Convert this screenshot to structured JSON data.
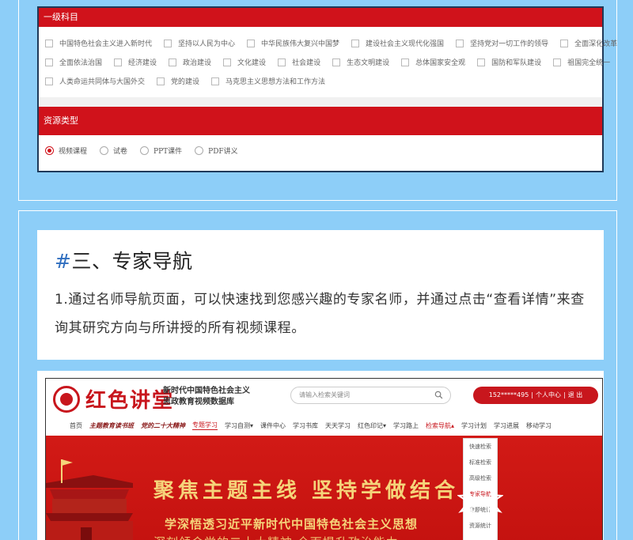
{
  "filter": {
    "section1_title": "一级科目",
    "subjects_row1": [
      "中国特色社会主义进入新时代",
      "坚持以人民为中心",
      "中华民族伟大复兴中国梦",
      "建设社会主义现代化强国",
      "坚持党对一切工作的领导",
      "全面深化改革"
    ],
    "subjects_row2": [
      "全面依法治国",
      "经济建设",
      "政治建设",
      "文化建设",
      "社会建设",
      "生态文明建设",
      "总体国家安全观",
      "国防和军队建设",
      "祖国完全统一"
    ],
    "subjects_row3": [
      "人类命运共同体与大国外交",
      "党的建设",
      "马克思主义思想方法和工作方法"
    ],
    "section2_title": "资源类型",
    "resource_types": [
      "视频课程",
      "试卷",
      "PPT课件",
      "PDF讲义"
    ],
    "selected_resource": "视频课程"
  },
  "section": {
    "hash": "#",
    "title": "三、专家导航",
    "description": "1.通过名师导航页面，可以快速找到您感兴趣的专家名师，并通过点击“查看详情”来查询其研究方向与所讲授的所有视频课程。"
  },
  "site": {
    "logo_title": "红色讲堂",
    "logo_subtitle_1": "新时代中国特色社会主义",
    "logo_subtitle_2": "思政教育视频数据库",
    "search_placeholder": "请输入检索关键词",
    "user_phone": "152*****495",
    "user_center": "个人中心",
    "logout": "退 出",
    "nav": [
      {
        "label": "首页",
        "style": "plain"
      },
      {
        "label": "主题教育读书班",
        "style": "italic"
      },
      {
        "label": "党的二十大精神",
        "style": "italic"
      },
      {
        "label": "专题学习",
        "style": "active"
      },
      {
        "label": "学习自测▾",
        "style": "plain"
      },
      {
        "label": "课件中心",
        "style": "plain"
      },
      {
        "label": "学习书库",
        "style": "plain"
      },
      {
        "label": "天天学习",
        "style": "plain"
      },
      {
        "label": "红色印记▾",
        "style": "plain"
      },
      {
        "label": "学习路上",
        "style": "plain"
      },
      {
        "label": "检索导航▴",
        "style": "red"
      },
      {
        "label": "学习计划",
        "style": "plain"
      },
      {
        "label": "学习进展",
        "style": "plain"
      },
      {
        "label": "移动学习",
        "style": "plain"
      }
    ],
    "dropdown": [
      "快速检索",
      "标准检索",
      "高级检索",
      "专家导航",
      "专题统计",
      "资源统计"
    ],
    "dropdown_highlight": "专家导航",
    "banner_title": "聚焦主题主线 坚持学做结合",
    "banner_sub": "学深悟透习近平新时代中国特色社会主义思想",
    "banner_sub2": "深刻领会党的二十大精神 全面提升政治能力"
  },
  "colors": {
    "red": "#d0121b",
    "gold": "#f5d47a",
    "background": "#8dcef8",
    "hash": "#2f6ebf"
  }
}
